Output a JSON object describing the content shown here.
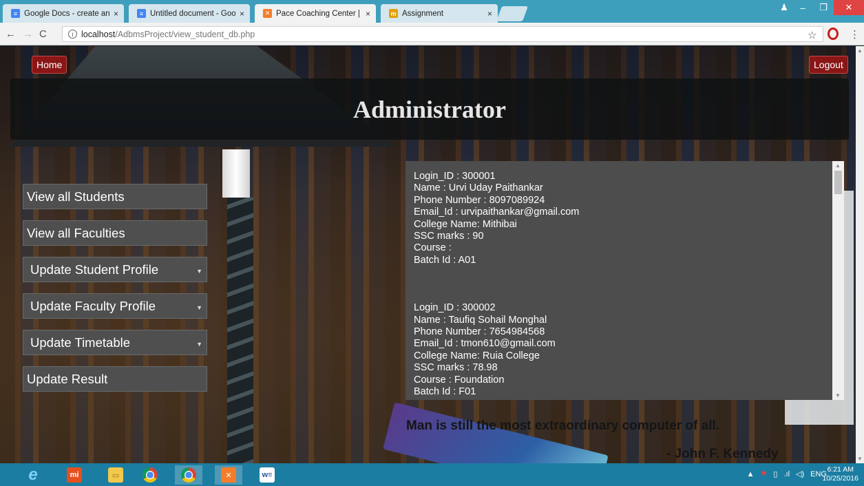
{
  "browser": {
    "tabs": [
      {
        "title": "Google Docs - create an",
        "icon": "docs-icon"
      },
      {
        "title": "Untitled document - Goo",
        "icon": "docs-icon"
      },
      {
        "title": "Pace Coaching Center | A",
        "icon": "xampp-icon"
      },
      {
        "title": "Assignment",
        "icon": "assignment-icon"
      }
    ],
    "close_glyph": "×",
    "url_host": "localhost",
    "url_path": "/AdbmsProject/view_student_db.php"
  },
  "page": {
    "home_label": "Home",
    "logout_label": "Logout",
    "heading": "Administrator",
    "menu": [
      {
        "label": "View all Students",
        "dropdown": false
      },
      {
        "label": "View all Faculties",
        "dropdown": false
      },
      {
        "label": "Update Student Profile",
        "dropdown": true
      },
      {
        "label": "Update Faculty Profile",
        "dropdown": true
      },
      {
        "label": "Update Timetable",
        "dropdown": true
      },
      {
        "label": "Update Result",
        "dropdown": false
      }
    ],
    "records": [
      {
        "login_id": "Login_ID : 300001",
        "name": "Name : Urvi Uday Paithankar",
        "phone": "Phone Number : 8097089924",
        "email": "Email_Id : urvipaithankar@gmail.com",
        "college": "College Name: Mithibai",
        "ssc": "SSC marks : 90",
        "course": "Course :",
        "batch": "Batch Id : A01"
      },
      {
        "login_id": "Login_ID : 300002",
        "name": "Name : Taufiq Sohail Monghal",
        "phone": "Phone Number : 7654984568",
        "email": "Email_Id : tmon610@gmail.com",
        "college": "College Name: Ruia College",
        "ssc": "SSC marks : 78.98",
        "course": "Course : Foundation",
        "batch": "Batch Id : F01"
      }
    ],
    "quote": "Man is still the most extraordinary computer of all.",
    "author": "- John F. Kennedy"
  },
  "taskbar": {
    "apps": [
      "internet-explorer-icon",
      "mi-icon",
      "file-explorer-icon",
      "chrome-icon",
      "chrome-icon",
      "xampp-icon",
      "word-icon"
    ],
    "language": "ENG",
    "time": "6:21 AM",
    "date": "10/25/2016"
  },
  "colors": {
    "titlebar": "#3e9fbd",
    "accent_red": "#8a1616",
    "panel": "#4d4d4d",
    "taskbar": "#1c7da2"
  }
}
